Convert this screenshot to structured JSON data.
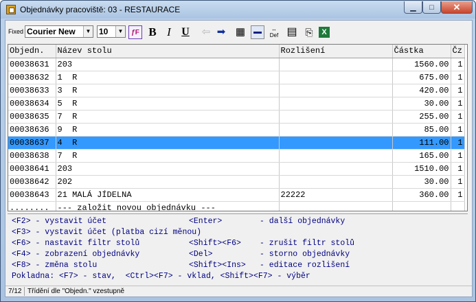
{
  "window": {
    "title": "Objednávky pracoviště: 03 - RESTAURACE"
  },
  "toolbar": {
    "fixed_label": "Fixed",
    "font": "Courier New",
    "size": "10"
  },
  "grid": {
    "columns": [
      "Objedn.",
      "Název stolu",
      "Rozlišení",
      "Částka",
      "Čz"
    ],
    "rows": [
      {
        "id": "00038631",
        "name": "203",
        "note": "",
        "amount": "1560.00",
        "cz": "1"
      },
      {
        "id": "00038632",
        "name": "1  R",
        "note": "",
        "amount": "675.00",
        "cz": "1"
      },
      {
        "id": "00038633",
        "name": "3  R",
        "note": "",
        "amount": "420.00",
        "cz": "1"
      },
      {
        "id": "00038634",
        "name": "5  R",
        "note": "",
        "amount": "30.00",
        "cz": "1"
      },
      {
        "id": "00038635",
        "name": "7  R",
        "note": "",
        "amount": "255.00",
        "cz": "1"
      },
      {
        "id": "00038636",
        "name": "9  R",
        "note": "",
        "amount": "85.00",
        "cz": "1"
      },
      {
        "id": "00038637",
        "name": "4  R",
        "note": "",
        "amount": "111.00",
        "cz": "1"
      },
      {
        "id": "00038638",
        "name": "7  R",
        "note": "",
        "amount": "165.00",
        "cz": "1"
      },
      {
        "id": "00038641",
        "name": "203",
        "note": "",
        "amount": "1510.00",
        "cz": "1"
      },
      {
        "id": "00038642",
        "name": "202",
        "note": "",
        "amount": "30.00",
        "cz": "1"
      },
      {
        "id": "00038643",
        "name": "21 MALÁ JÍDELNA",
        "note": "22222",
        "amount": "360.00",
        "cz": "1"
      }
    ],
    "selected_index": 6,
    "new_row": {
      "dots": "........",
      "label": "--- založit novou objednávku ---"
    }
  },
  "help": {
    "l1a": "<F2> - vystavit účet",
    "l1b": "<Enter>",
    "l1c": "- další objednávky",
    "l2": "<F3> - vystavit účet (platba cizí měnou)",
    "l3a": "<F6> - nastavit filtr stolů",
    "l3b": "<Shift><F6>",
    "l3c": "- zrušit filtr stolů",
    "l4a": "<F4> - zobrazení objednávky",
    "l4b": "<Del>",
    "l4c": "- storno objednávky",
    "l5a": "<F8> - změna stolu",
    "l5b": "<Shift><Ins>",
    "l5c": "- editace rozlišení",
    "l6": "Pokladna: <F7> - stav,  <Ctrl><F7> - vklad, <Shift><F7> - výběr"
  },
  "status": {
    "position": "7/12",
    "sort": "Třídění dle \"Objedn.\" vzestupně"
  }
}
